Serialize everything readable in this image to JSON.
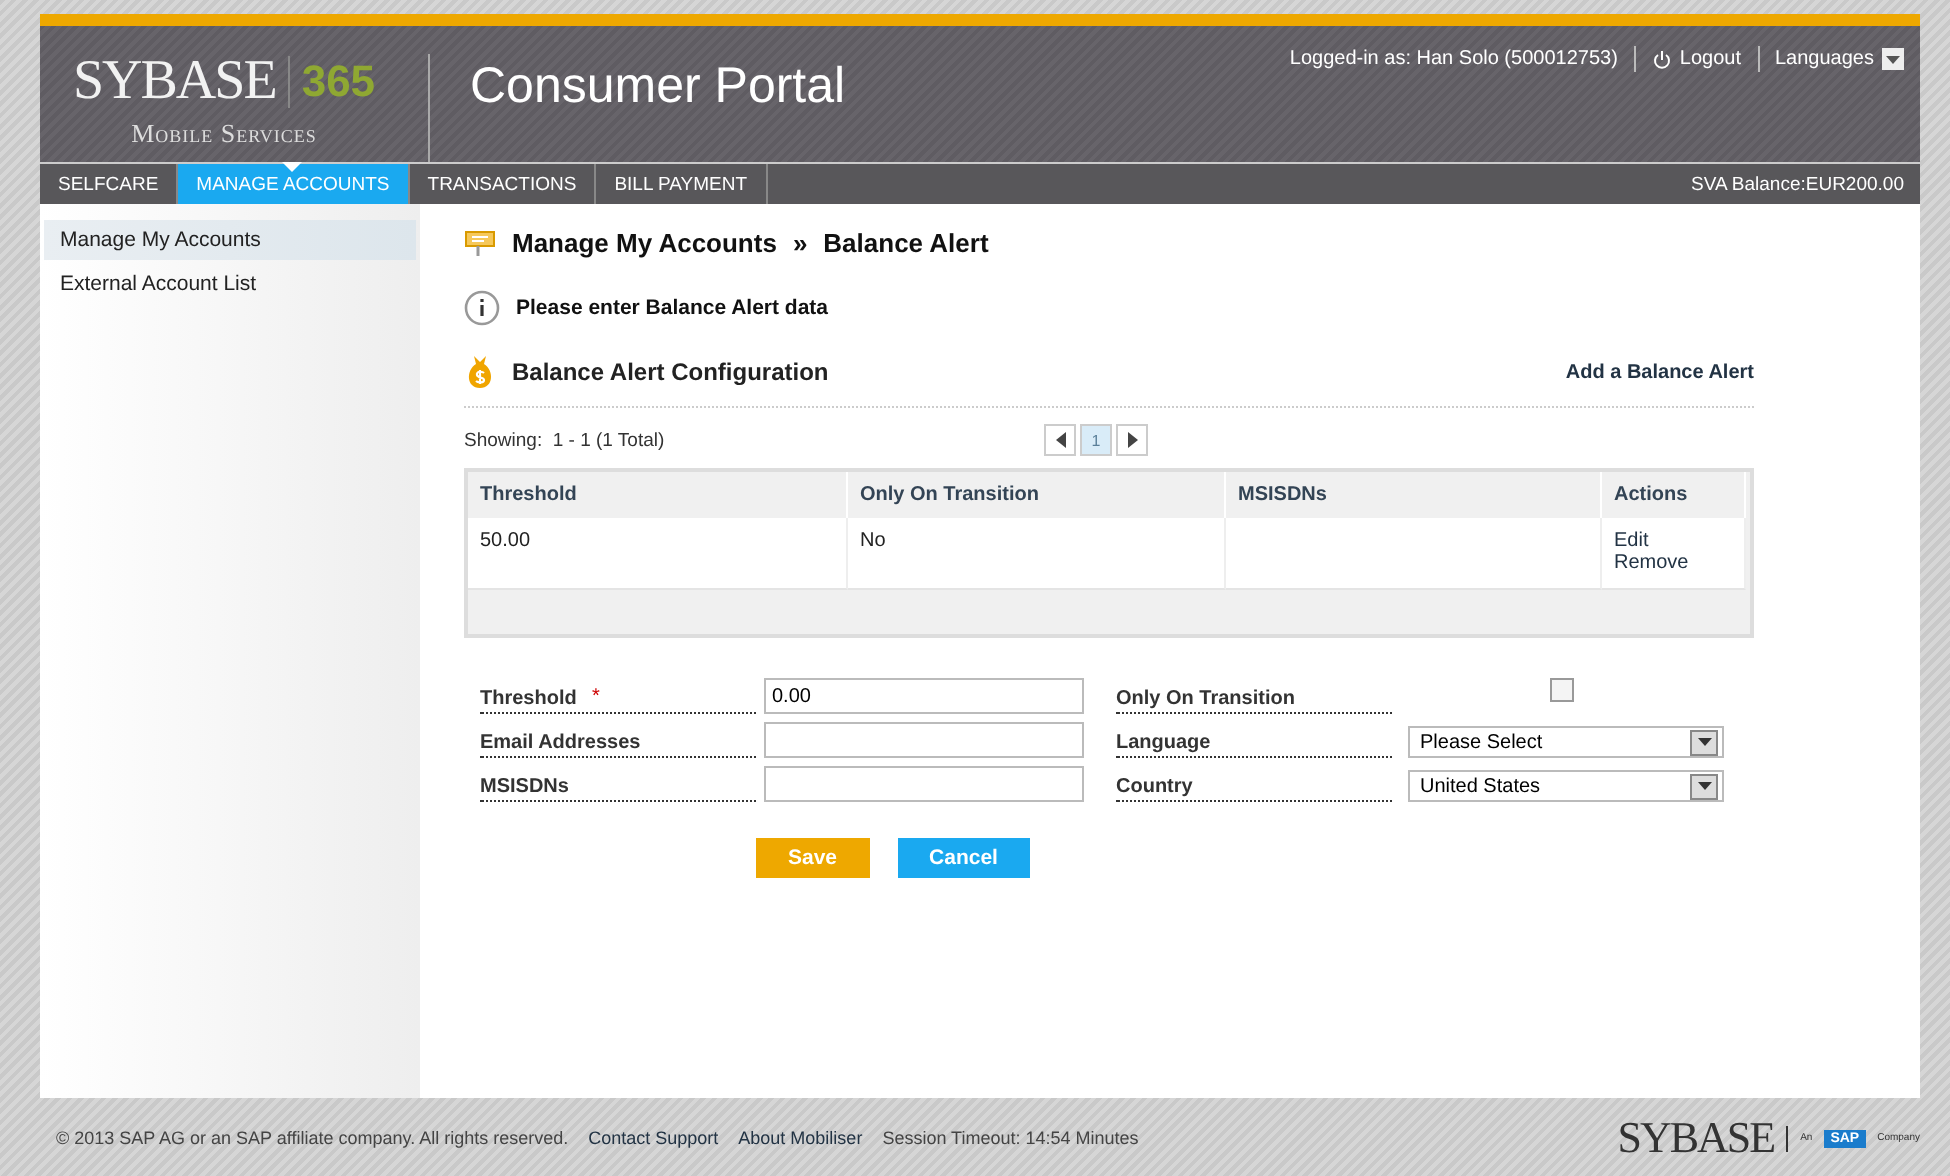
{
  "logo": {
    "brand": "SYBASE",
    "number": "365",
    "tagline": "Mobile Services"
  },
  "portal_title": "Consumer Portal",
  "user_bar": {
    "logged_in": "Logged-in as: Han Solo (500012753)",
    "logout": "Logout",
    "languages": "Languages"
  },
  "nav_tabs": [
    {
      "label": "SELFCARE",
      "selected": false
    },
    {
      "label": "MANAGE ACCOUNTS",
      "selected": true
    },
    {
      "label": "TRANSACTIONS",
      "selected": false
    },
    {
      "label": "BILL PAYMENT",
      "selected": false
    }
  ],
  "balance": "SVA Balance:EUR200.00",
  "sidebar": {
    "items": [
      {
        "label": "Manage My Accounts",
        "selected": true
      },
      {
        "label": "External Account List",
        "selected": false
      }
    ]
  },
  "breadcrumb": {
    "parent": "Manage My Accounts",
    "separator": "»",
    "current": "Balance Alert"
  },
  "info_message": "Please enter Balance Alert data",
  "section": {
    "title": "Balance Alert Configuration",
    "add_link": "Add a Balance Alert"
  },
  "pager": {
    "showing": "Showing:  1 - 1 (1 Total)",
    "page": "1"
  },
  "table": {
    "columns": [
      "Threshold",
      "Only On Transition",
      "MSISDNs",
      "Actions"
    ],
    "rows": [
      {
        "threshold": "50.00",
        "only_on_transition": "No",
        "actions": [
          "Edit",
          "Remove"
        ]
      }
    ]
  },
  "form": {
    "left": [
      {
        "label": "Threshold",
        "required_mark": "*",
        "value": "0.00"
      },
      {
        "label": "Email Addresses"
      },
      {
        "label": "MSISDNs"
      }
    ],
    "right": [
      {
        "label": "Only On Transition",
        "kind": "checkbox",
        "checked": false
      },
      {
        "label": "Language",
        "kind": "select",
        "value": "Please Select"
      },
      {
        "label": "Country",
        "kind": "select",
        "value": "United States"
      }
    ],
    "buttons": [
      {
        "label": "Save",
        "kind": "primary"
      },
      {
        "label": "Cancel",
        "kind": "secondary"
      }
    ]
  },
  "footer": {
    "copyright": "© 2013 SAP AG or an SAP affiliate company. All rights reserved.",
    "links": [
      "Contact Support",
      "About Mobiliser"
    ],
    "session": "Session Timeout: 14:54 Minutes",
    "logo": {
      "brand": "SYBASE",
      "an": "An",
      "sap": "SAP",
      "company": "Company"
    }
  }
}
